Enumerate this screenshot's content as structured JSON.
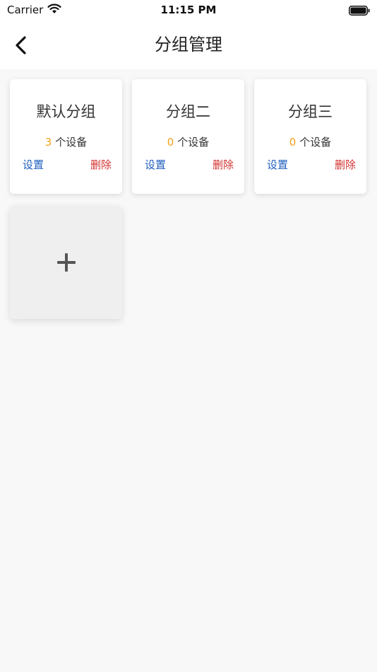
{
  "status_bar": {
    "carrier": "Carrier",
    "time": "11:15 PM"
  },
  "header": {
    "title": "分组管理"
  },
  "groups": [
    {
      "name": "默认分组",
      "count": "3",
      "count_suffix": "个设备",
      "settings_label": "设置",
      "delete_label": "删除"
    },
    {
      "name": "分组二",
      "count": "0",
      "count_suffix": "个设备",
      "settings_label": "设置",
      "delete_label": "删除"
    },
    {
      "name": "分组三",
      "count": "0",
      "count_suffix": "个设备",
      "settings_label": "设置",
      "delete_label": "删除"
    }
  ],
  "colors": {
    "count_accent": "#f0a31a",
    "settings": "#1f5fbf",
    "delete": "#d43030"
  },
  "icons": {
    "back": "chevron-left-icon",
    "add": "plus-icon",
    "wifi": "wifi-icon",
    "battery": "battery-icon"
  }
}
